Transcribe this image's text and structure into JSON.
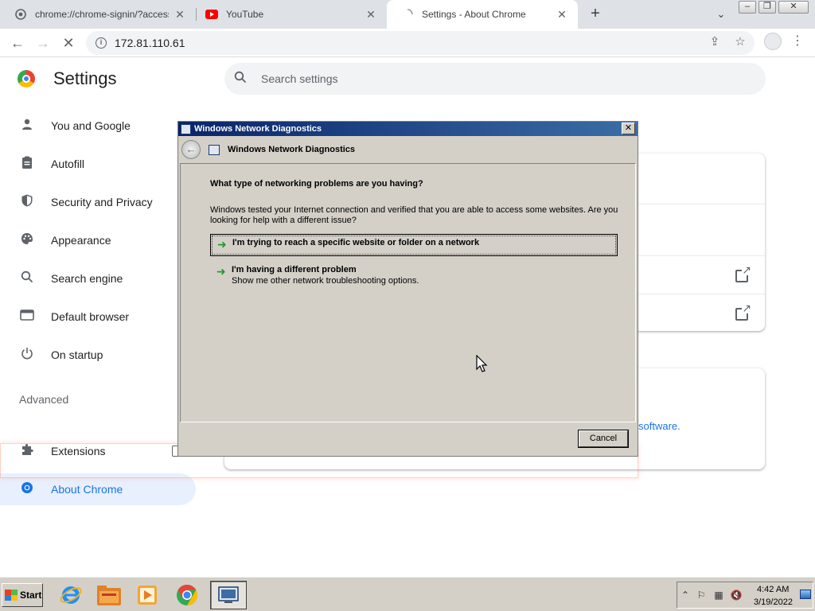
{
  "browser": {
    "tabs": [
      {
        "title": "chrome://chrome-signin/?access_po",
        "close": "✕"
      },
      {
        "title": "YouTube",
        "close": "✕"
      },
      {
        "title": "Settings - About Chrome",
        "close": "✕"
      }
    ],
    "new_tab": "+",
    "tab_search": "⌄",
    "window_controls": {
      "minimize": "–",
      "restore": "❐",
      "close": "✕"
    },
    "url": "172.81.110.61",
    "nav": {
      "back": "←",
      "forward": "→",
      "stop": "✕"
    }
  },
  "settings": {
    "title": "Settings",
    "search_placeholder": "Search settings",
    "nav_items": [
      {
        "label": "You and Google",
        "icon": "person-icon"
      },
      {
        "label": "Autofill",
        "icon": "clipboard-icon"
      },
      {
        "label": "Security and Privacy",
        "icon": "shield-icon"
      },
      {
        "label": "Appearance",
        "icon": "palette-icon"
      },
      {
        "label": "Search engine",
        "icon": "search-icon"
      },
      {
        "label": "Default browser",
        "icon": "browser-icon"
      },
      {
        "label": "On startup",
        "icon": "power-icon"
      }
    ],
    "advanced_label": "Advanced",
    "extensions_label": "Extensions",
    "about_label": "About Chrome",
    "software_link": "software."
  },
  "dialog": {
    "window_title": "Windows Network Diagnostics",
    "header_title": "Windows Network Diagnostics",
    "question": "What type of networking problems are you having?",
    "description": "Windows tested your Internet connection and verified that you are able to access some websites. Are you looking for help with a different issue?",
    "options": [
      {
        "label": "I'm trying to reach a specific website or folder on a network",
        "subtext": ""
      },
      {
        "label": "I'm having a different problem",
        "subtext": "Show me other network troubleshooting options."
      }
    ],
    "cancel_label": "Cancel"
  },
  "taskbar": {
    "start_label": "Start",
    "apps": [
      "internet-explorer-icon",
      "file-explorer-icon",
      "media-player-icon",
      "chrome-icon",
      "network-diagnostics-icon"
    ],
    "clock_time": "4:42 AM",
    "clock_date": "3/19/2022"
  },
  "colors": {
    "chrome_accent": "#1a73e8",
    "win_title_start": "#0a246a",
    "win_title_end": "#3a6ea5",
    "win_face": "#d4d0c8"
  }
}
